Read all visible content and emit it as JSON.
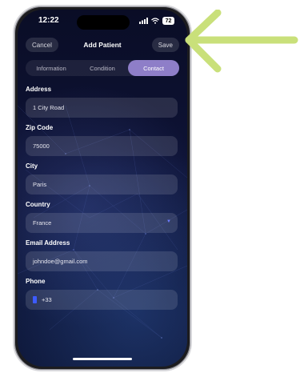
{
  "status_bar": {
    "time": "12:22",
    "battery": "72"
  },
  "nav": {
    "cancel_label": "Cancel",
    "title": "Add Patient",
    "save_label": "Save"
  },
  "tabs": [
    {
      "label": "Information",
      "active": false
    },
    {
      "label": "Condition",
      "active": false
    },
    {
      "label": "Contact",
      "active": true
    }
  ],
  "form": {
    "address": {
      "label": "Address",
      "value": "1 City Road"
    },
    "zip_code": {
      "label": "Zip Code",
      "value": "75000"
    },
    "city": {
      "label": "City",
      "value": "Paris"
    },
    "country": {
      "label": "Country",
      "value": "France"
    },
    "email": {
      "label": "Email Address",
      "value": "johndoe@gmail.com"
    },
    "phone": {
      "label": "Phone",
      "value": "+33"
    }
  },
  "colors": {
    "accent": "#8e7ec8",
    "arrow": "#c9e07a",
    "background": "#0c1130"
  },
  "icons": {
    "arrow": "arrow-left-icon",
    "chevron": "chevron-down-icon",
    "flag": "flag-icon"
  }
}
